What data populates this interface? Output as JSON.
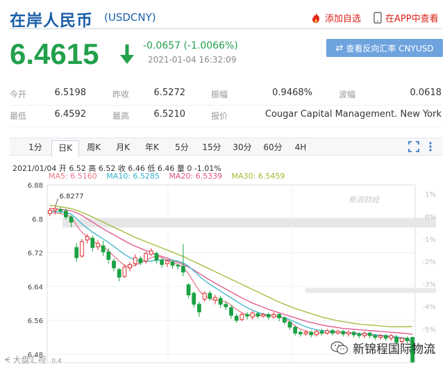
{
  "header": {
    "title": "在岸人民币",
    "code": "(USDCNY)",
    "add_favorite": "添加自选",
    "in_app": "在APP中查看"
  },
  "quote": {
    "price": "6.4615",
    "change": "-0.0657 (-1.0066%)",
    "time": "2021-01-04 16:32:09",
    "reverse_button": "查看反向汇率 CNYUSD"
  },
  "stats": {
    "rows": [
      [
        {
          "label": "今开",
          "value": "6.5198"
        },
        {
          "label": "昨收",
          "value": "6.5272"
        },
        {
          "label": "振幅",
          "value": "0.9468%"
        },
        {
          "label": "波幅",
          "value": "0.0618"
        }
      ],
      [
        {
          "label": "最低",
          "value": "6.4592"
        },
        {
          "label": "最高",
          "value": "6.5210"
        },
        {
          "label": "报价",
          "value": "Cougar Capital Management. New York"
        }
      ]
    ]
  },
  "tabs": [
    "1分",
    "日K",
    "周K",
    "月K",
    "年K",
    "5分",
    "15分",
    "30分",
    "60分",
    "4H"
  ],
  "active_tab": "日K",
  "chart_info": {
    "ohlc_line": "2021/01/04 开 6.52 高 6.52 收 6.46 低 6.46 量 0 -1.01%",
    "ma5": "MA5: 6.5160",
    "ma10": "MA10: 6.5285",
    "ma20": "MA20: 6.5339",
    "ma30": "MA30: 6.5459",
    "high_marker": "6.8277",
    "watermark": "新浪财经",
    "bottom_left_watermark": "大盘汇视",
    "bottom_left_tick": "0.4",
    "bottom_right_watermark": "新锦程国际物流"
  },
  "colors": {
    "up": "#e02b2b",
    "down": "#1aa142",
    "ma5": "#e8778a",
    "ma10": "#38b3cd",
    "ma20": "#e0508a",
    "ma30": "#9cbb32",
    "title_blue": "#1b5fa8"
  },
  "chart_data": {
    "type": "candlestick",
    "y_ticks": [
      "6.88",
      "6.8",
      "6.72",
      "6.64",
      "6.56",
      "6.48"
    ],
    "y_range": [
      6.46,
      6.88
    ],
    "pct_ticks": [
      "1%",
      "0%",
      "-1%",
      "-2%",
      "-3%",
      "-4%",
      "-5%",
      "-6%"
    ],
    "pct_range": [
      -6.5,
      1.4
    ],
    "candles": [
      [
        6.812,
        6.82,
        6.826,
        6.806
      ],
      [
        6.82,
        6.824,
        6.828,
        6.81
      ],
      [
        6.822,
        6.818,
        6.827,
        6.812
      ],
      [
        6.818,
        6.804,
        6.824,
        6.798
      ],
      [
        6.804,
        6.792,
        6.808,
        6.78
      ],
      [
        6.732,
        6.708,
        6.742,
        6.698
      ],
      [
        6.712,
        6.746,
        6.752,
        6.708
      ],
      [
        6.75,
        6.758,
        6.764,
        6.742
      ],
      [
        6.754,
        6.732,
        6.76,
        6.722
      ],
      [
        6.734,
        6.742,
        6.75,
        6.726
      ],
      [
        6.736,
        6.722,
        6.748,
        6.712
      ],
      [
        6.722,
        6.704,
        6.73,
        6.694
      ],
      [
        6.7,
        6.684,
        6.706,
        6.676
      ],
      [
        6.68,
        6.662,
        6.684,
        6.652
      ],
      [
        6.664,
        6.686,
        6.692,
        6.66
      ],
      [
        6.684,
        6.692,
        6.698,
        6.676
      ],
      [
        6.694,
        6.708,
        6.716,
        6.688
      ],
      [
        6.706,
        6.696,
        6.712,
        6.69
      ],
      [
        6.7,
        6.718,
        6.722,
        6.694
      ],
      [
        6.716,
        6.724,
        6.73,
        6.712
      ],
      [
        6.718,
        6.702,
        6.722,
        6.694
      ],
      [
        6.702,
        6.692,
        6.708,
        6.684
      ],
      [
        6.694,
        6.7,
        6.704,
        6.686
      ],
      [
        6.698,
        6.69,
        6.702,
        6.682
      ],
      [
        6.69,
        6.688,
        6.694,
        6.68
      ],
      [
        6.688,
        6.674,
        6.74,
        6.664
      ],
      [
        6.644,
        6.62,
        6.648,
        6.612
      ],
      [
        6.624,
        6.598,
        6.628,
        6.59
      ],
      [
        6.598,
        6.58,
        6.604,
        6.568
      ],
      [
        6.61,
        6.624,
        6.628,
        6.604
      ],
      [
        6.624,
        6.612,
        6.63,
        6.606
      ],
      [
        6.608,
        6.614,
        6.62,
        6.598
      ],
      [
        6.612,
        6.598,
        6.618,
        6.59
      ],
      [
        6.598,
        6.592,
        6.604,
        6.584
      ],
      [
        6.59,
        6.572,
        6.596,
        6.564
      ],
      [
        6.57,
        6.56,
        6.576,
        6.554
      ],
      [
        6.562,
        6.574,
        6.578,
        6.558
      ],
      [
        6.574,
        6.57,
        6.58,
        6.562
      ],
      [
        6.568,
        6.578,
        6.582,
        6.562
      ],
      [
        6.576,
        6.57,
        6.58,
        6.564
      ],
      [
        6.57,
        6.574,
        6.578,
        6.566
      ],
      [
        6.574,
        6.568,
        6.578,
        6.562
      ],
      [
        6.568,
        6.574,
        6.58,
        6.564
      ],
      [
        6.574,
        6.566,
        6.578,
        6.558
      ],
      [
        6.566,
        6.556,
        6.57,
        6.55
      ],
      [
        6.556,
        6.544,
        6.56,
        6.538
      ],
      [
        6.544,
        6.53,
        6.548,
        6.524
      ],
      [
        6.532,
        6.528,
        6.536,
        6.522
      ],
      [
        6.528,
        6.532,
        6.536,
        6.524
      ],
      [
        6.532,
        6.526,
        6.536,
        6.52
      ],
      [
        6.526,
        6.534,
        6.538,
        6.522
      ],
      [
        6.534,
        6.53,
        6.54,
        6.524
      ],
      [
        6.53,
        6.536,
        6.54,
        6.526
      ],
      [
        6.536,
        6.53,
        6.54,
        6.524
      ],
      [
        6.53,
        6.534,
        6.538,
        6.526
      ],
      [
        6.534,
        6.528,
        6.538,
        6.522
      ],
      [
        6.528,
        6.532,
        6.536,
        6.522
      ],
      [
        6.532,
        6.526,
        6.536,
        6.52
      ],
      [
        6.528,
        6.524,
        6.532,
        6.518
      ],
      [
        6.524,
        6.53,
        6.534,
        6.518
      ],
      [
        6.53,
        6.524,
        6.534,
        6.518
      ],
      [
        6.524,
        6.52,
        6.528,
        6.514
      ],
      [
        6.52,
        6.524,
        6.528,
        6.514
      ],
      [
        6.524,
        6.518,
        6.528,
        6.512
      ],
      [
        6.518,
        6.524,
        6.528,
        6.512
      ],
      [
        6.52,
        6.508,
        6.526,
        6.504
      ],
      [
        6.51,
        6.518,
        6.52,
        6.504
      ],
      [
        6.518,
        6.512,
        6.522,
        6.506
      ],
      [
        6.52,
        6.462,
        6.521,
        6.459
      ]
    ],
    "ma5": [
      6.815,
      6.814,
      6.812,
      6.809,
      6.805,
      6.785,
      6.768,
      6.758,
      6.748,
      6.74,
      6.734,
      6.724,
      6.712,
      6.7,
      6.69,
      6.686,
      6.69,
      6.696,
      6.702,
      6.708,
      6.712,
      6.708,
      6.702,
      6.698,
      6.692,
      6.686,
      6.67,
      6.65,
      6.63,
      6.618,
      6.612,
      6.608,
      6.606,
      6.604,
      6.596,
      6.586,
      6.578,
      6.574,
      6.572,
      6.572,
      6.572,
      6.572,
      6.571,
      6.569,
      6.565,
      6.557,
      6.547,
      6.539,
      6.535,
      6.531,
      6.53,
      6.53,
      6.531,
      6.532,
      6.532,
      6.531,
      6.53,
      6.529,
      6.528,
      6.527,
      6.526,
      6.524,
      6.523,
      6.522,
      6.521,
      6.518,
      6.516,
      6.515,
      6.506
    ],
    "ma10": [
      6.818,
      6.817,
      6.816,
      6.814,
      6.811,
      6.8,
      6.788,
      6.778,
      6.768,
      6.76,
      6.752,
      6.744,
      6.735,
      6.725,
      6.716,
      6.708,
      6.703,
      6.7,
      6.699,
      6.7,
      6.702,
      6.703,
      6.703,
      6.702,
      6.7,
      6.696,
      6.688,
      6.677,
      6.665,
      6.654,
      6.645,
      6.637,
      6.629,
      6.621,
      6.613,
      6.605,
      6.597,
      6.59,
      6.584,
      6.579,
      6.575,
      6.573,
      6.571,
      6.569,
      6.566,
      6.562,
      6.556,
      6.55,
      6.545,
      6.541,
      6.538,
      6.536,
      6.535,
      6.534,
      6.533,
      6.532,
      6.531,
      6.53,
      6.529,
      6.528,
      6.527,
      6.526,
      6.525,
      6.524,
      6.523,
      6.521,
      6.519,
      6.517,
      6.512
    ],
    "ma20": [
      6.824,
      6.823,
      6.822,
      6.821,
      6.819,
      6.814,
      6.808,
      6.8,
      6.792,
      6.784,
      6.776,
      6.769,
      6.762,
      6.755,
      6.748,
      6.741,
      6.735,
      6.73,
      6.725,
      6.72,
      6.715,
      6.711,
      6.707,
      6.702,
      6.697,
      6.692,
      6.686,
      6.679,
      6.671,
      6.663,
      6.655,
      6.648,
      6.641,
      6.634,
      6.627,
      6.62,
      6.613,
      6.607,
      6.601,
      6.596,
      6.591,
      6.586,
      6.582,
      6.578,
      6.574,
      6.57,
      6.566,
      6.562,
      6.558,
      6.555,
      6.552,
      6.549,
      6.547,
      6.545,
      6.543,
      6.541,
      6.54,
      6.539,
      6.538,
      6.537,
      6.536,
      6.535,
      6.534,
      6.533,
      6.532,
      6.531,
      6.53,
      6.529,
      6.527
    ],
    "ma30": [
      6.832,
      6.83,
      6.828,
      6.826,
      6.824,
      6.82,
      6.815,
      6.81,
      6.804,
      6.798,
      6.792,
      6.786,
      6.78,
      6.774,
      6.768,
      6.762,
      6.756,
      6.751,
      6.746,
      6.741,
      6.736,
      6.731,
      6.726,
      6.721,
      6.716,
      6.711,
      6.705,
      6.699,
      6.693,
      6.687,
      6.681,
      6.675,
      6.669,
      6.663,
      6.657,
      6.651,
      6.645,
      6.639,
      6.633,
      6.627,
      6.621,
      6.615,
      6.609,
      6.603,
      6.598,
      6.593,
      6.588,
      6.584,
      6.58,
      6.576,
      6.572,
      6.568,
      6.565,
      6.562,
      6.559,
      6.557,
      6.555,
      6.553,
      6.551,
      6.55,
      6.549,
      6.548,
      6.547,
      6.546,
      6.545,
      6.545,
      6.545,
      6.545,
      6.546
    ]
  }
}
